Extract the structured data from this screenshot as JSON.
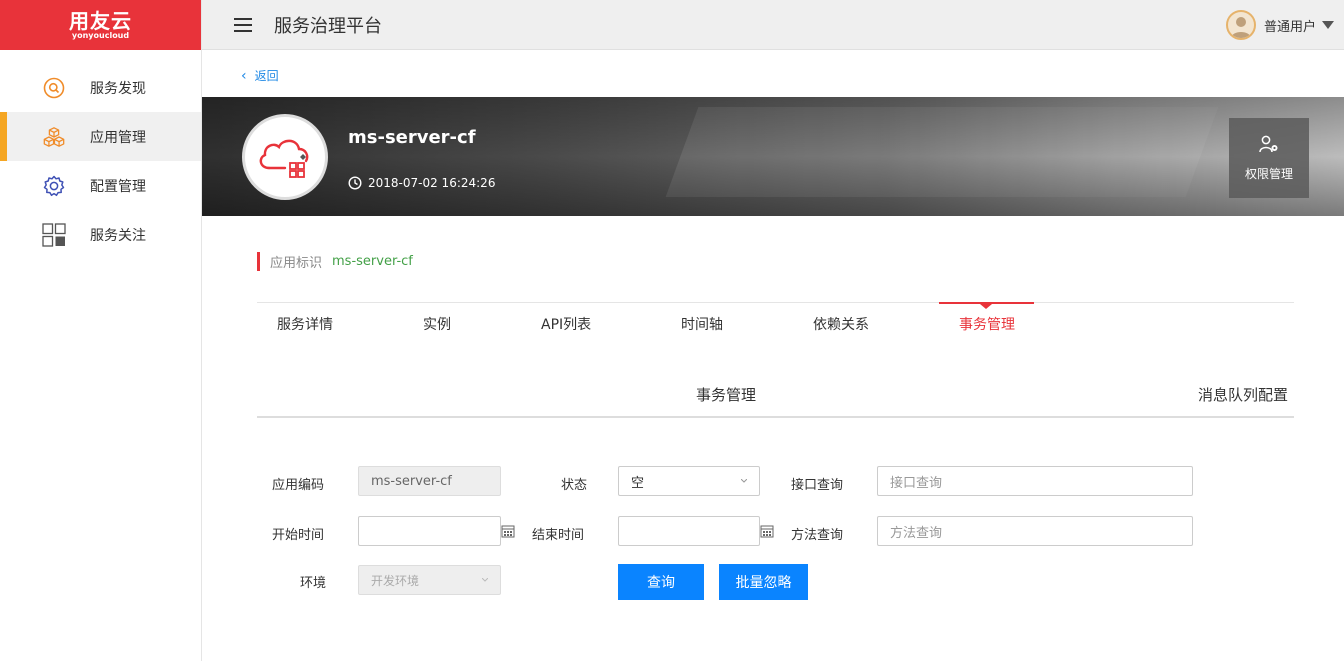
{
  "brand": {
    "logo_cn": "用友云",
    "logo_en": "yonyoucloud",
    "color": "#e8333a"
  },
  "sidebar": {
    "items": [
      {
        "label": "服务发现",
        "icon": "search-circle-icon"
      },
      {
        "label": "应用管理",
        "icon": "cubes-icon",
        "active": true
      },
      {
        "label": "配置管理",
        "icon": "gear-icon"
      },
      {
        "label": "服务关注",
        "icon": "grid-icon"
      }
    ]
  },
  "header": {
    "title": "服务治理平台",
    "user": "普通用户"
  },
  "back_label": "返回",
  "app": {
    "name": "ms-server-cf",
    "created": "2018-07-02 16:24:26",
    "permission_label": "权限管理",
    "id_label": "应用标识",
    "id_value": "ms-server-cf"
  },
  "tabs": [
    "服务详情",
    "实例",
    "API列表",
    "时间轴",
    "依赖关系",
    "事务管理"
  ],
  "active_tab": "事务管理",
  "subtabs": [
    "事务管理",
    "消息队列配置"
  ],
  "form": {
    "app_code_label": "应用编码",
    "app_code_value": "ms-server-cf",
    "status_label": "状态",
    "status_value": "空",
    "api_query_label": "接口查询",
    "api_query_placeholder": "接口查询",
    "start_time_label": "开始时间",
    "end_time_label": "结束时间",
    "method_query_label": "方法查询",
    "method_query_placeholder": "方法查询",
    "env_label": "环境",
    "env_value": "开发环境",
    "query_button": "查询",
    "batch_ignore_button": "批量忽略"
  },
  "colors": {
    "accent": "#e8333a",
    "primary": "#0a84ff",
    "active_bar": "#f5a623",
    "id_value": "#43a047"
  }
}
